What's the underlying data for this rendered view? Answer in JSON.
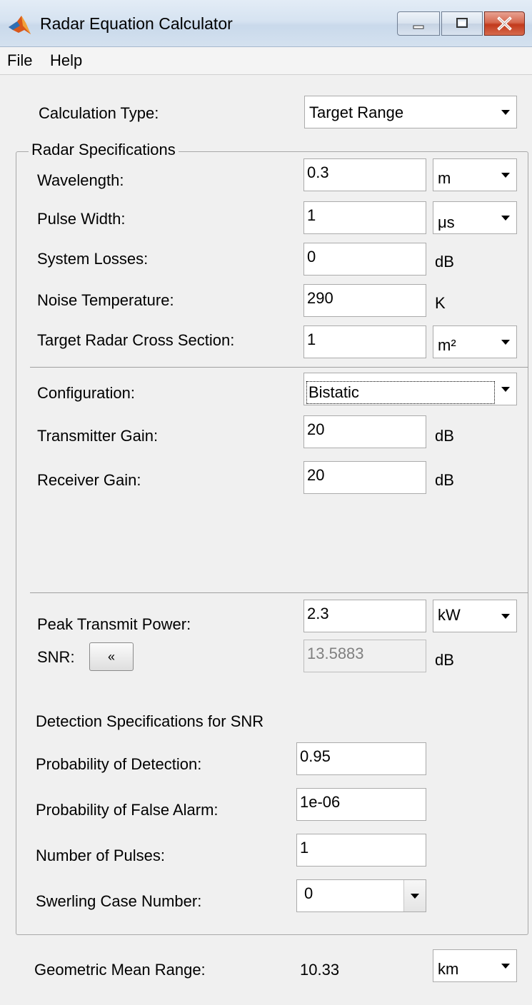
{
  "window": {
    "title": "Radar Equation Calculator",
    "icon": "matlab-logo-icon",
    "controls": [
      "minimize-icon",
      "maximize-icon",
      "close-icon"
    ],
    "close_color": "#c23a1c"
  },
  "menu": {
    "file": "File",
    "help": "Help"
  },
  "calculation_type": {
    "label": "Calculation Type:",
    "value": "Target Range"
  },
  "radar_specs": {
    "title": "Radar Specifications",
    "wavelength": {
      "label": "Wavelength:",
      "value": "0.3",
      "unit": "m"
    },
    "pulse_width": {
      "label": "Pulse Width:",
      "value": "1",
      "unit": "μs"
    },
    "system_losses": {
      "label": "System Losses:",
      "value": "0",
      "unit": "dB"
    },
    "noise_temperature": {
      "label": "Noise Temperature:",
      "value": "290",
      "unit": "K"
    },
    "target_rcs": {
      "label": "Target Radar Cross Section:",
      "value": "1",
      "unit": "m²"
    },
    "configuration": {
      "label": "Configuration:",
      "value": "Bistatic"
    },
    "transmitter_gain": {
      "label": "Transmitter Gain:",
      "value": "20",
      "unit": "dB"
    },
    "receiver_gain": {
      "label": "Receiver Gain:",
      "value": "20",
      "unit": "dB"
    },
    "peak_power": {
      "label": "Peak Transmit Power:",
      "value": "2.3",
      "unit": "kW"
    },
    "snr": {
      "label": "SNR:",
      "button": "«",
      "value": "13.5883",
      "unit": "dB"
    }
  },
  "detection_specs": {
    "title": "Detection Specifications for SNR",
    "pd": {
      "label": "Probability of Detection:",
      "value": "0.95"
    },
    "pfa": {
      "label": "Probability of False Alarm:",
      "value": "1e-06"
    },
    "num_pulses": {
      "label": "Number of Pulses:",
      "value": "1"
    },
    "swerling": {
      "label": "Swerling Case Number:",
      "value": "0"
    }
  },
  "result": {
    "label": "Geometric Mean Range:",
    "value": "10.33",
    "unit": "km"
  }
}
